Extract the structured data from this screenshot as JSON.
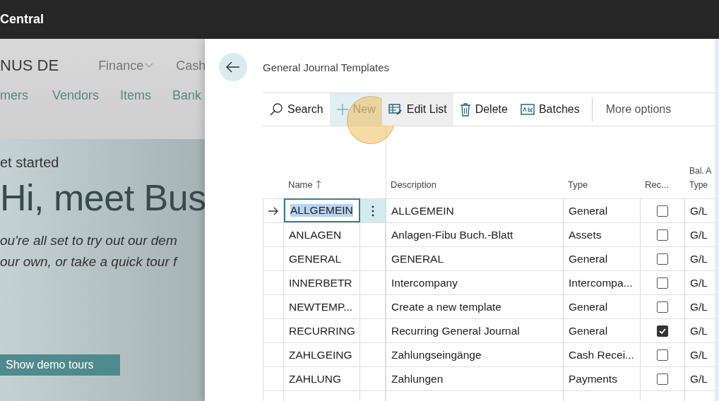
{
  "top_bar": {
    "title": "Central"
  },
  "background_page": {
    "company": "NUS DE",
    "menu": [
      {
        "label": "Finance",
        "dropdown": true
      },
      {
        "label": "Cash",
        "dropdown": false
      }
    ],
    "nav": [
      "mers",
      "Vendors",
      "Items",
      "Bank"
    ],
    "hero": {
      "eyebrow": "et started",
      "heading": "Hi, meet Bus",
      "text_lines": [
        "ou're all set to try out our dem",
        "our own, or take a quick tour f"
      ],
      "button": "Show demo tours"
    }
  },
  "page": {
    "title": "General Journal Templates",
    "actions": [
      {
        "label": "Search",
        "kind": "search",
        "disabled": false,
        "pressed": false,
        "hovered": false,
        "clicked": false
      },
      {
        "label": "New",
        "kind": "new",
        "disabled": true,
        "pressed": true,
        "hovered": false,
        "clicked": true
      },
      {
        "label": "Edit List",
        "kind": "edit",
        "disabled": false,
        "pressed": false,
        "hovered": true,
        "clicked": false
      },
      {
        "label": "Delete",
        "kind": "delete",
        "disabled": false,
        "pressed": false,
        "hovered": false,
        "clicked": false
      },
      {
        "label": "Batches",
        "kind": "batches",
        "disabled": false,
        "pressed": false,
        "hovered": false,
        "clicked": false
      }
    ],
    "more": "More options",
    "table": {
      "columns": [
        {
          "label": "Name",
          "sorted": true
        },
        {
          "label": "Description",
          "sorted": false
        },
        {
          "label": "Type",
          "sorted": false
        },
        {
          "label": "Rec...",
          "sorted": false
        },
        {
          "label": "Bal. A",
          "label_2": "Type"
        }
      ],
      "rows": [
        {
          "name": "ALLGEMEIN",
          "description": "ALLGEMEIN",
          "type": "General",
          "recurring": false,
          "bal_type": "G/L",
          "selected": true
        },
        {
          "name": "ANLAGEN",
          "description": "Anlagen-Fibu Buch.-Blatt",
          "type": "Assets",
          "recurring": false,
          "bal_type": "G/L",
          "selected": false
        },
        {
          "name": "GENERAL",
          "description": "GENERAL",
          "type": "General",
          "recurring": false,
          "bal_type": "G/L",
          "selected": false
        },
        {
          "name": "INNERBETR",
          "description": "Intercompany",
          "type": "Intercompa...",
          "recurring": false,
          "bal_type": "G/L",
          "selected": false
        },
        {
          "name": "NEWTEMP...",
          "description": "Create a new template",
          "type": "General",
          "recurring": false,
          "bal_type": "G/L",
          "selected": false
        },
        {
          "name": "RECURRING",
          "description": "Recurring General Journal",
          "type": "General",
          "recurring": true,
          "bal_type": "G/L",
          "selected": false
        },
        {
          "name": "ZAHLGEING",
          "description": "Zahlungseingänge",
          "type": "Cash Recei...",
          "recurring": false,
          "bal_type": "G/L",
          "selected": false
        },
        {
          "name": "ZAHLUNG",
          "description": "Zahlungen",
          "type": "Payments",
          "recurring": false,
          "bal_type": "G/L",
          "selected": false
        }
      ]
    }
  }
}
